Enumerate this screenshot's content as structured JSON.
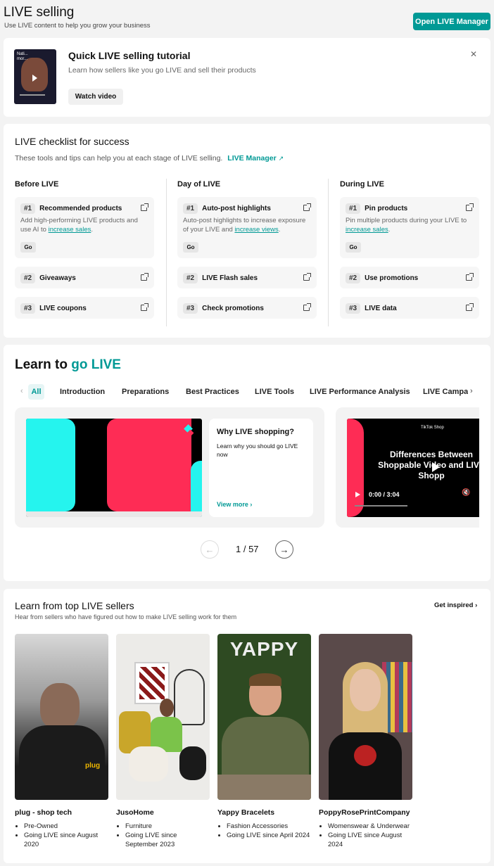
{
  "header": {
    "title": "LIVE selling",
    "subtitle": "Use LIVE content to help you grow your business",
    "open_manager_label": "Open LIVE Manager"
  },
  "tutorial": {
    "title": "Quick LIVE selling tutorial",
    "description": "Learn how sellers like you go LIVE and sell their products",
    "watch_label": "Watch video",
    "close_icon": "close-icon",
    "thumb_text": "Nati... mor..."
  },
  "checklist": {
    "title": "LIVE checklist for success",
    "description": "These tools and tips can help you at each stage of LIVE selling.",
    "manager_link": "LIVE Manager",
    "columns": [
      {
        "title": "Before LIVE",
        "items": [
          {
            "num": "#1",
            "label": "Recommended products",
            "desc_pre": "Add high-performing LIVE products and use AI to ",
            "desc_link": "increase sales",
            "desc_post": ".",
            "go": "Go"
          },
          {
            "num": "#2",
            "label": "Giveaways"
          },
          {
            "num": "#3",
            "label": "LIVE coupons"
          }
        ]
      },
      {
        "title": "Day of LIVE",
        "items": [
          {
            "num": "#1",
            "label": "Auto-post highlights",
            "desc_pre": "Auto-post highlights to increase exposure of your LIVE and ",
            "desc_link": "increase views",
            "desc_post": ".",
            "go": "Go"
          },
          {
            "num": "#2",
            "label": "LIVE Flash sales"
          },
          {
            "num": "#3",
            "label": "Check promotions"
          }
        ]
      },
      {
        "title": "During LIVE",
        "items": [
          {
            "num": "#1",
            "label": "Pin products",
            "desc_pre": "Pin multiple products during your LIVE to ",
            "desc_link": "increase sales",
            "desc_post": ".",
            "go": "Go"
          },
          {
            "num": "#2",
            "label": "Use promotions"
          },
          {
            "num": "#3",
            "label": "LIVE data"
          }
        ]
      }
    ]
  },
  "learn": {
    "title_pre": "Learn to ",
    "title_accent": "go LIVE",
    "tabs": [
      "All",
      "Introduction",
      "Preparations",
      "Best Practices",
      "LIVE Tools",
      "LIVE Performance Analysis",
      "LIVE Campai"
    ],
    "card1": {
      "title": "Why LIVE shopping?",
      "desc": "Learn why you should go LIVE now",
      "view_more": "View more"
    },
    "card2": {
      "brand": "TikTok Shop",
      "video_title": "Differences Between Shoppable Video and LIVE Shopp",
      "time": "0:00 / 3:04"
    },
    "pagination": "1 / 57"
  },
  "sellers": {
    "title": "Learn from top LIVE sellers",
    "subtitle": "Hear from sellers who have figured out how to make LIVE selling work for them",
    "get_inspired": "Get inspired",
    "items": [
      {
        "name": "plug - shop tech",
        "category": "Pre-Owned",
        "since": "Going LIVE since August 2020",
        "overlay": "plug"
      },
      {
        "name": "JusoHome",
        "category": "Furniture",
        "since": "Going LIVE since September 2023",
        "overlay": ""
      },
      {
        "name": "Yappy Bracelets",
        "category": "Fashion Accessories",
        "since": "Going LIVE since April 2024",
        "overlay": "YAPPY"
      },
      {
        "name": "PoppyRosePrintCompany",
        "category": "Womenswear & Underwear",
        "since": "Going LIVE since August 2024",
        "overlay": ""
      }
    ]
  },
  "colors": {
    "accent": "#009995",
    "tiktok_cyan": "#25f4ee",
    "tiktok_red": "#fe2c55"
  }
}
